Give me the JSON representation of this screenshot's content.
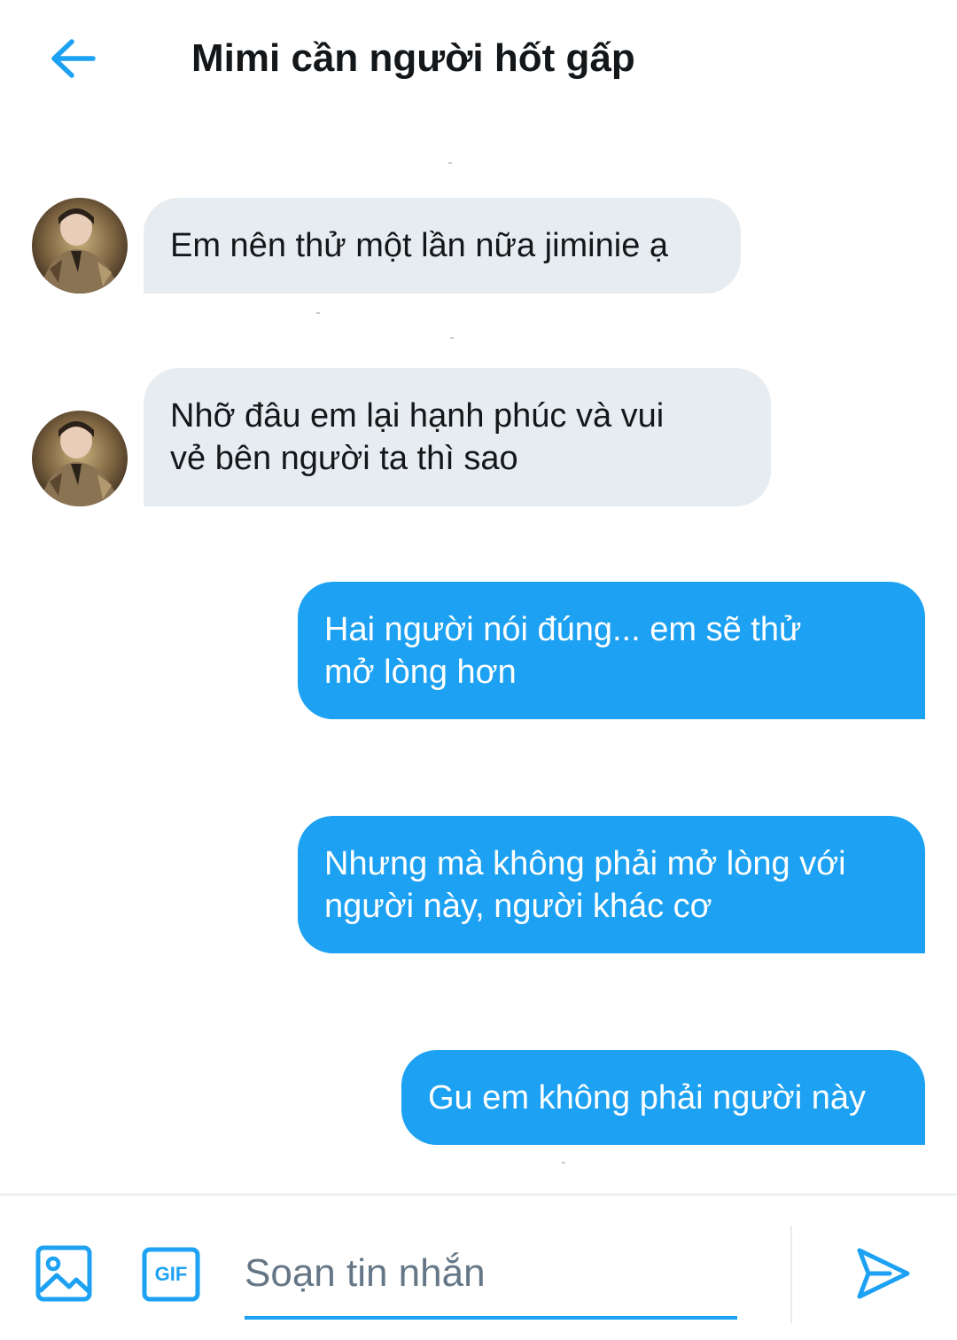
{
  "header": {
    "title": "Mimi cần người hốt gấp",
    "back_icon": "arrow-left-icon"
  },
  "colors": {
    "accent": "#1da1f2",
    "incoming_bubble": "#e6ecf0",
    "text": "#14171a",
    "placeholder": "#657786"
  },
  "messages": [
    {
      "direction": "incoming",
      "lines": [
        "Em nên thử một lần nữa jiminie ạ"
      ]
    },
    {
      "direction": "incoming",
      "lines": [
        "Nhỡ đâu em lại hạnh phúc và vui",
        "vẻ bên người ta thì sao"
      ]
    },
    {
      "direction": "outgoing",
      "lines": [
        "Hai người nói đúng... em sẽ thử",
        "mở lòng hơn"
      ]
    },
    {
      "direction": "outgoing",
      "lines": [
        "Nhưng mà không phải mở lòng với",
        "người này, người khác cơ"
      ]
    },
    {
      "direction": "outgoing",
      "lines": [
        "Gu em không phải người này"
      ]
    }
  ],
  "composer": {
    "placeholder": "Soạn tin nhắn",
    "media_icon": "image-icon",
    "gif_label": "GIF",
    "send_icon": "send-icon"
  }
}
